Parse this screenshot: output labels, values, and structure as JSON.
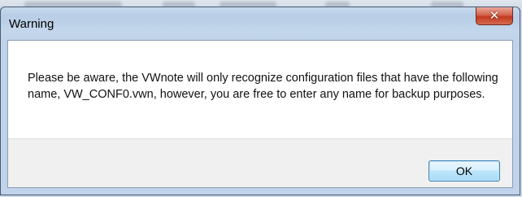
{
  "dialog": {
    "title": "Warning",
    "close_glyph": "✕",
    "message": "Please be aware, the VWnote will only recognize configuration files that have the following name, VW_CONF0.vwn, however, you are free to enter any name for backup purposes.",
    "ok_label": "OK"
  },
  "icons": {
    "close": "close-icon"
  },
  "colors": {
    "close_button": "#c9432a",
    "ok_button_border": "#3c7fb1",
    "titlebar": "#bcd1e8"
  }
}
